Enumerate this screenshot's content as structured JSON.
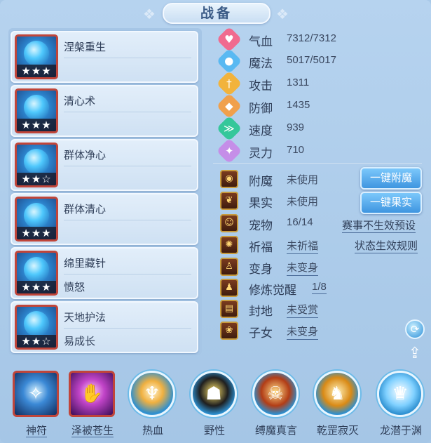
{
  "window": {
    "title": "战备"
  },
  "skills": [
    {
      "name": "涅槃重生",
      "sub": "",
      "stars": "★★★"
    },
    {
      "name": "清心术",
      "sub": "",
      "stars": "★★★"
    },
    {
      "name": "群体净心",
      "sub": "",
      "stars": "★★☆"
    },
    {
      "name": "群体清心",
      "sub": "",
      "stars": "★★★"
    },
    {
      "name": "绵里藏针",
      "sub": "愤怒",
      "stars": "★★★"
    },
    {
      "name": "天地护法",
      "sub": "易成长",
      "stars": "★★☆"
    }
  ],
  "stats": [
    {
      "label": "气血",
      "value": "7312/7312",
      "icon": "heart-icon",
      "color": "#f06b8f",
      "glyph": "♥"
    },
    {
      "label": "魔法",
      "value": "5017/5017",
      "icon": "mana-icon",
      "color": "#59b9f2",
      "glyph": "●"
    },
    {
      "label": "攻击",
      "value": "1311",
      "icon": "sword-icon",
      "color": "#f2b33c",
      "glyph": "†"
    },
    {
      "label": "防御",
      "value": "1435",
      "icon": "shield-icon",
      "color": "#f0a04c",
      "glyph": "◆"
    },
    {
      "label": "速度",
      "value": "939",
      "icon": "speed-icon",
      "color": "#35c79a",
      "glyph": "≫"
    },
    {
      "label": "灵力",
      "value": "710",
      "icon": "spirit-icon",
      "color": "#c58ee8",
      "glyph": "✦"
    }
  ],
  "status": [
    {
      "label": "附魔",
      "value": "未使用",
      "icon": "enchant-icon",
      "glyph": "◉",
      "underline": false
    },
    {
      "label": "果实",
      "value": "未使用",
      "icon": "fruit-icon",
      "glyph": "❦",
      "underline": false
    },
    {
      "label": "宠物",
      "value": "16/14",
      "icon": "pet-icon",
      "glyph": "☺",
      "underline": false
    },
    {
      "label": "祈福",
      "value": "未祈福",
      "icon": "bless-icon",
      "glyph": "✺",
      "underline": true
    },
    {
      "label": "变身",
      "value": "未变身",
      "icon": "transform-icon",
      "glyph": "♙",
      "underline": true
    },
    {
      "label": "修炼觉醒",
      "value": "1/8",
      "icon": "cultivate-icon",
      "glyph": "♟",
      "underline": true
    },
    {
      "label": "封地",
      "value": "未受赏",
      "icon": "fief-icon",
      "glyph": "▤",
      "underline": true
    },
    {
      "label": "子女",
      "value": "未变身",
      "icon": "child-icon",
      "glyph": "❀",
      "underline": true
    }
  ],
  "buttons": {
    "enchant": "一键附魔",
    "fruit": "一键果实"
  },
  "links": {
    "preset": "赛事不生效预设",
    "rules": "状态生效规则"
  },
  "bottom_bar": [
    {
      "label": "神符",
      "icon": "rune-icon",
      "underline": true
    },
    {
      "label": "泽被苍生",
      "icon": "palm-icon",
      "underline": true
    },
    {
      "label": "热血",
      "icon": "hotblood-icon",
      "underline": false
    },
    {
      "label": "野性",
      "icon": "wild-icon",
      "underline": false
    },
    {
      "label": "缚魔真言",
      "icon": "bind-demon-icon",
      "underline": false
    },
    {
      "label": "乾罡寂灭",
      "icon": "qiangang-icon",
      "underline": false
    },
    {
      "label": "龙潜于渊",
      "icon": "dragon-icon",
      "underline": false
    }
  ]
}
